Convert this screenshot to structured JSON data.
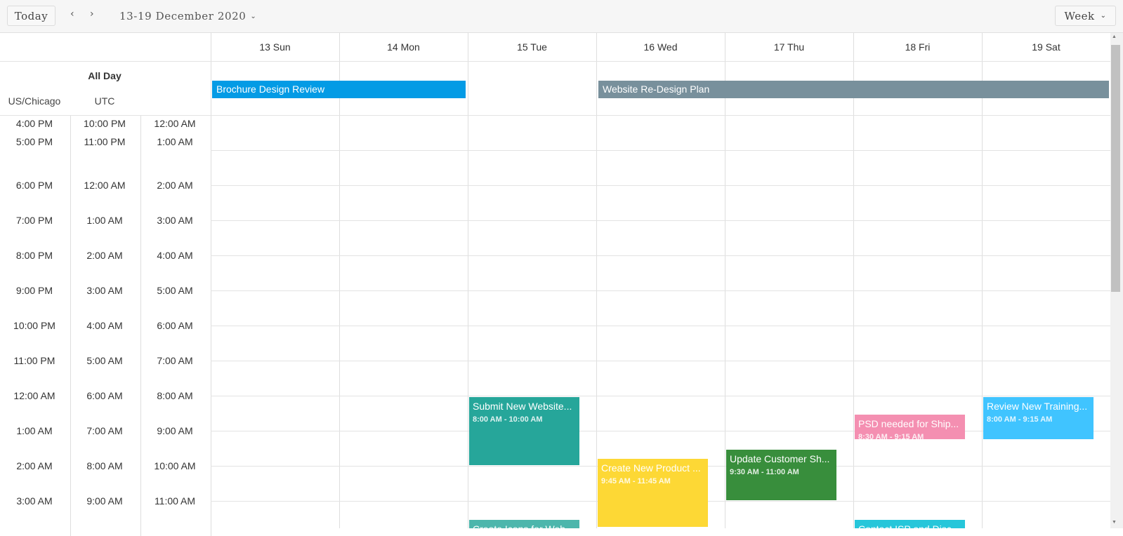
{
  "toolbar": {
    "today_label": "Today",
    "prev_icon": "‹",
    "next_icon": "›",
    "date_range": "13-19 December 2020",
    "view_label": "Week",
    "chevron": "⌄"
  },
  "days": [
    "13 Sun",
    "14 Mon",
    "15 Tue",
    "16 Wed",
    "17 Thu",
    "18 Fri",
    "19 Sat"
  ],
  "allday_label": "All Day",
  "timezones": [
    "US/Chicago",
    "UTC"
  ],
  "times": {
    "chicago": [
      "4:00 PM",
      "5:00 PM",
      "6:00 PM",
      "7:00 PM",
      "8:00 PM",
      "9:00 PM",
      "10:00 PM",
      "11:00 PM",
      "12:00 AM",
      "1:00 AM",
      "2:00 AM",
      "3:00 AM"
    ],
    "utc": [
      "10:00 PM",
      "11:00 PM",
      "12:00 AM",
      "1:00 AM",
      "2:00 AM",
      "3:00 AM",
      "4:00 AM",
      "5:00 AM",
      "6:00 AM",
      "7:00 AM",
      "8:00 AM",
      "9:00 AM"
    ],
    "local": [
      "12:00 AM",
      "1:00 AM",
      "2:00 AM",
      "3:00 AM",
      "4:00 AM",
      "5:00 AM",
      "6:00 AM",
      "7:00 AM",
      "8:00 AM",
      "9:00 AM",
      "10:00 AM",
      "11:00 AM"
    ]
  },
  "allday_events": [
    {
      "title": "Brochure Design Review",
      "color": "#039be5"
    },
    {
      "title": "Website Re-Design Plan",
      "color": "#78909c"
    }
  ],
  "events": [
    {
      "title": "Submit New Website...",
      "time": "8:00 AM - 10:00 AM",
      "color": "#26a69a"
    },
    {
      "title": "Create New Product ...",
      "time": "9:45 AM - 11:45 AM",
      "color": "#fdd835"
    },
    {
      "title": "Update Customer Sh...",
      "time": "9:30 AM - 11:00 AM",
      "color": "#388e3c"
    },
    {
      "title": "PSD needed for Ship...",
      "time": "8:30 AM - 9:15 AM",
      "color": "#f48fb1"
    },
    {
      "title": "Review New Training...",
      "time": "8:00 AM - 9:15 AM",
      "color": "#40c4ff"
    },
    {
      "title": "Create Icons for Web...",
      "time": "",
      "color": "#4db6ac"
    },
    {
      "title": "Contact ISP and Disc...",
      "time": "",
      "color": "#26c6da"
    }
  ]
}
